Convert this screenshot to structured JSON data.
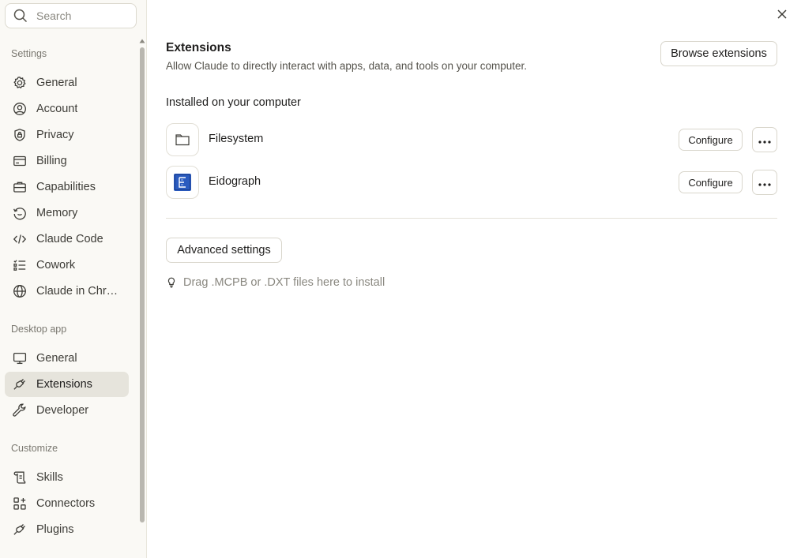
{
  "search": {
    "placeholder": "Search"
  },
  "sidebar": {
    "sections": [
      {
        "label": "Settings"
      },
      {
        "label": "Desktop app"
      },
      {
        "label": "Customize"
      }
    ],
    "items": [
      {
        "label": "General",
        "icon": "gear-icon"
      },
      {
        "label": "Account",
        "icon": "user-circle-icon"
      },
      {
        "label": "Privacy",
        "icon": "shield-lock-icon"
      },
      {
        "label": "Billing",
        "icon": "credit-card-icon"
      },
      {
        "label": "Capabilities",
        "icon": "briefcase-icon"
      },
      {
        "label": "Memory",
        "icon": "memory-icon"
      },
      {
        "label": "Claude Code",
        "icon": "code-icon"
      },
      {
        "label": "Cowork",
        "icon": "checklist-icon"
      },
      {
        "label": "Claude in Chr…",
        "icon": "globe-icon"
      },
      {
        "label": "General",
        "icon": "monitor-icon"
      },
      {
        "label": "Extensions",
        "icon": "plug-icon",
        "active": true
      },
      {
        "label": "Developer",
        "icon": "wrench-icon"
      },
      {
        "label": "Skills",
        "icon": "scroll-icon"
      },
      {
        "label": "Connectors",
        "icon": "connectors-icon"
      },
      {
        "label": "Plugins",
        "icon": "plug-icon"
      }
    ]
  },
  "main": {
    "title": "Extensions",
    "subtitle": "Allow Claude to directly interact with apps, data, and tools on your computer.",
    "browse_label": "Browse extensions",
    "installed_heading": "Installed on your computer",
    "extensions": [
      {
        "name": "Filesystem",
        "icon": "folder-icon",
        "configure_label": "Configure"
      },
      {
        "name": "Eidograph",
        "icon": "eidograph-logo-icon",
        "configure_label": "Configure"
      }
    ],
    "advanced_label": "Advanced settings",
    "drag_hint": "Drag .MCPB or .DXT files here to install"
  },
  "colors": {
    "sidebar_bg": "#faf9f5",
    "active_item_bg": "#e6e4dc",
    "eidograph_blue": "#2a5bbf"
  }
}
